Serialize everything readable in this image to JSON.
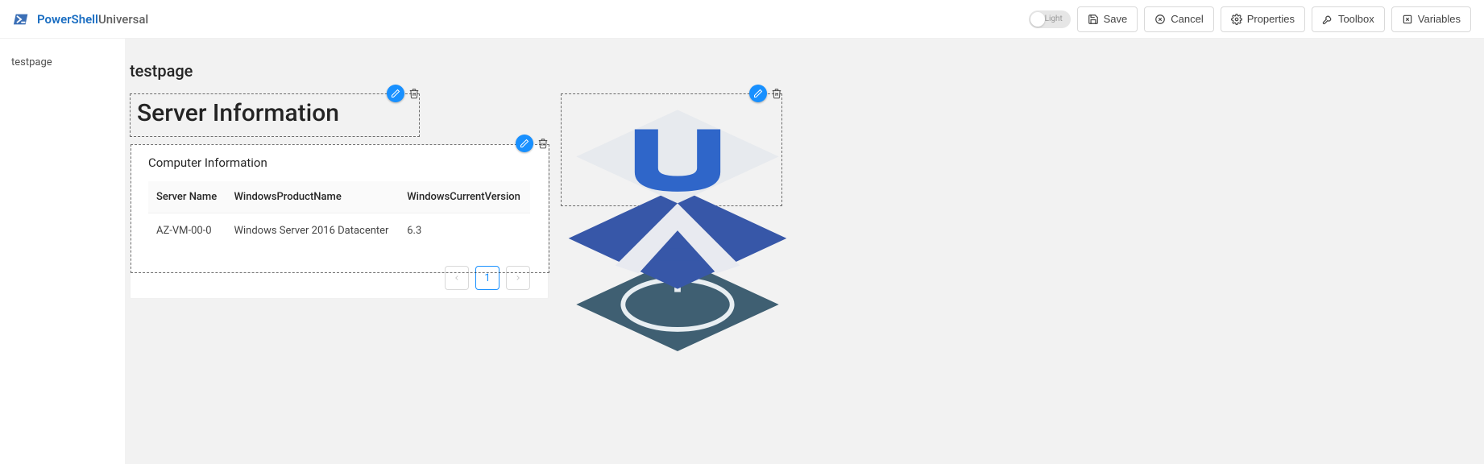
{
  "brand": {
    "part1": "PowerShell",
    "part2": "Universal"
  },
  "toolbar": {
    "theme_label": "Light",
    "save": "Save",
    "cancel": "Cancel",
    "properties": "Properties",
    "toolbox": "Toolbox",
    "variables": "Variables"
  },
  "sidebar": {
    "items": [
      {
        "label": "testpage"
      }
    ]
  },
  "page": {
    "title": "testpage",
    "heading_widget": {
      "text": "Server Information"
    },
    "card": {
      "title": "Computer Information",
      "columns": [
        "Server Name",
        "WindowsProductName",
        "WindowsCurrentVersion"
      ],
      "rows": [
        {
          "server_name": "AZ-VM-00-0",
          "product": "Windows Server 2016 Datacenter",
          "version": "6.3"
        }
      ],
      "pagination": {
        "current": "1"
      }
    }
  }
}
